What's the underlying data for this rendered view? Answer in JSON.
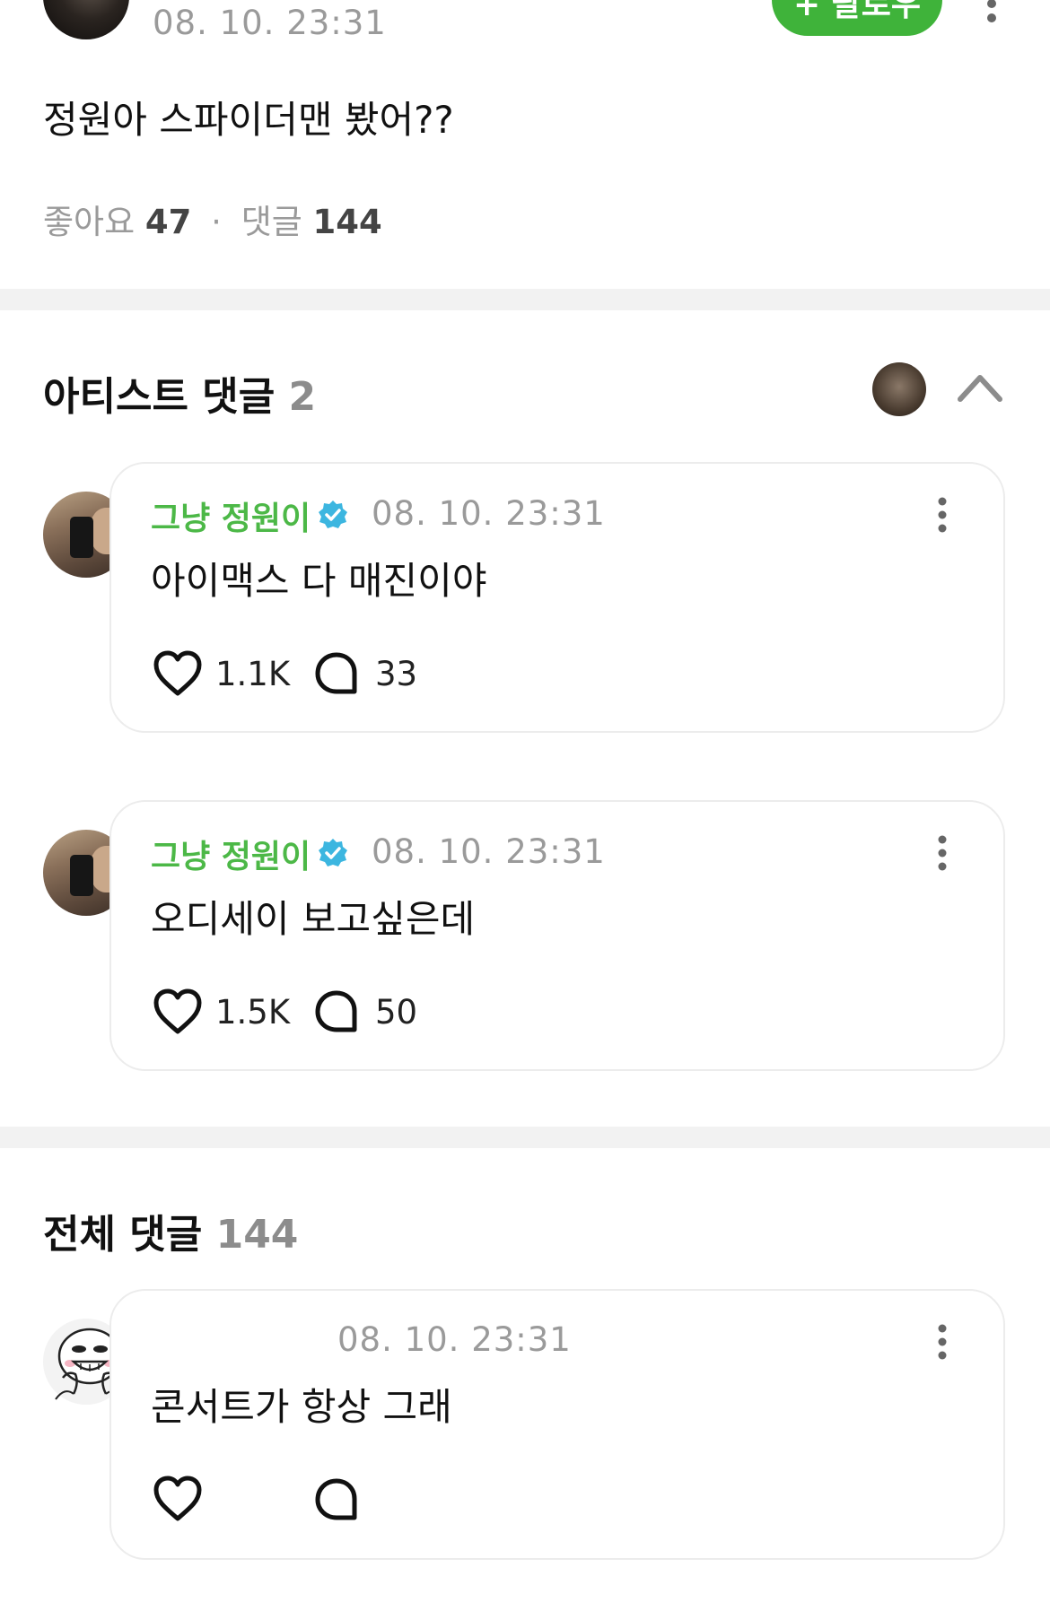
{
  "post": {
    "time": "08. 10. 23:31",
    "follow_label": "+ 팔로우",
    "body": "정원아 스파이더맨 봤어??",
    "likes_label": "좋아요",
    "likes": "47",
    "separator": "·",
    "comments_label": "댓글",
    "comments": "144"
  },
  "artist_section": {
    "title": "아티스트 댓글",
    "count": "2"
  },
  "artist_comments": [
    {
      "author": "그냥 정원이",
      "time": "08. 10. 23:31",
      "text": "아이맥스 다 매진이야",
      "likes": "1.1K",
      "replies": "33"
    },
    {
      "author": "그냥 정원이",
      "time": "08. 10. 23:31",
      "text": "오디세이 보고싶은데",
      "likes": "1.5K",
      "replies": "50"
    }
  ],
  "all_section": {
    "title": "전체 댓글",
    "count": "144"
  },
  "all_comments": [
    {
      "time": "08. 10. 23:31",
      "text": "콘서트가 항상 그래"
    }
  ],
  "colors": {
    "accent_green": "#3fb33a",
    "author_green": "#4cb847",
    "verified_blue": "#3cb6e0"
  },
  "icons": [
    "more-vertical-icon",
    "chevron-up-icon",
    "verified-badge-icon",
    "heart-icon",
    "comment-bubble-icon"
  ]
}
